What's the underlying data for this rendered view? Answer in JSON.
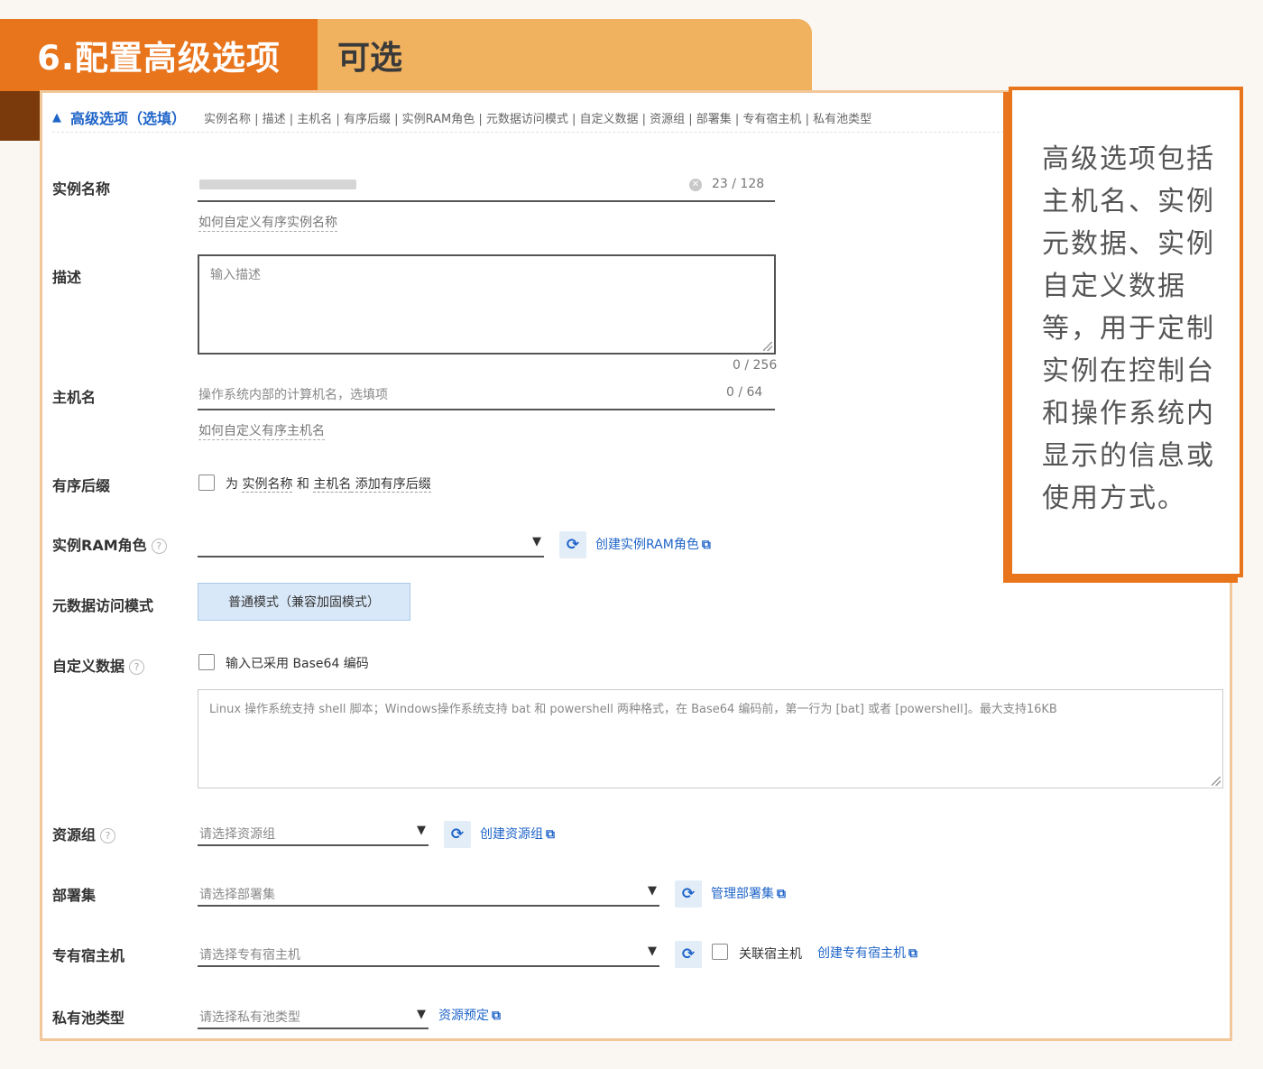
{
  "banner": {
    "title": "6.配置高级选项",
    "optional": "可选"
  },
  "advanced": {
    "caret": "▲",
    "title": "高级选项（选填）",
    "fields_list": "实例名称 | 描述 | 主机名 | 有序后缀 | 实例RAM角色 | 元数据访问模式 | 自定义数据 | 资源组 | 部署集 | 专有宿主机 | 私有池类型"
  },
  "instance_name": {
    "label": "实例名称",
    "counter": "23 / 128",
    "hint": "如何自定义有序实例名称"
  },
  "description": {
    "label": "描述",
    "placeholder": "输入描述",
    "counter": "0 / 256"
  },
  "hostname": {
    "label": "主机名",
    "placeholder": "操作系统内部的计算机名，选填项",
    "counter": "0 / 64",
    "hint": "如何自定义有序主机名"
  },
  "ordered_suffix": {
    "label": "有序后缀",
    "text_prefix": "为 ",
    "link1": "实例名称",
    "text_mid": " 和 ",
    "link2": "主机名",
    "text_suffix": " 添加有序后缀"
  },
  "ram_role": {
    "label": "实例RAM角色",
    "link": "创建实例RAM角色"
  },
  "metadata_mode": {
    "label": "元数据访问模式",
    "button": "普通模式（兼容加固模式）"
  },
  "user_data": {
    "label": "自定义数据",
    "checkbox_label": "输入已采用 Base64 编码",
    "placeholder": "Linux 操作系统支持 shell 脚本；Windows操作系统支持 bat 和 powershell 两种格式，在 Base64 编码前，第一行为 [bat] 或者 [powershell]。最大支持16KB"
  },
  "resource_group": {
    "label": "资源组",
    "placeholder": "请选择资源组",
    "link": "创建资源组"
  },
  "deployment_set": {
    "label": "部署集",
    "placeholder": "请选择部署集",
    "link": "管理部署集"
  },
  "dedicated_host": {
    "label": "专有宿主机",
    "placeholder": "请选择专有宿主机",
    "checkbox_label": "关联宿主机",
    "link": "创建专有宿主机"
  },
  "private_pool": {
    "label": "私有池类型",
    "placeholder": "请选择私有池类型",
    "link": "资源预定"
  },
  "callout": {
    "text": "高级选项包括主机名、实例元数据、实例自定义数据等，用于定制实例在控制台和操作系统内显示的信息或使用方式。"
  },
  "colors": {
    "accent": "#e8741c",
    "banner_light": "#f0b25f",
    "link": "#1f64c8"
  },
  "icons": {
    "refresh": "refresh-icon",
    "external": "external-link-icon",
    "help": "help-icon",
    "dropdown": "dropdown-arrow-icon",
    "clear": "clear-icon"
  }
}
